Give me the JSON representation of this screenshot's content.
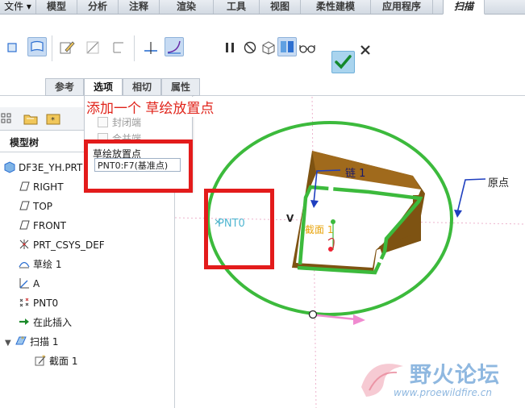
{
  "menubar": {
    "file": "文件",
    "items": [
      "模型",
      "分析",
      "注释",
      "渲染",
      "工具",
      "视图",
      "柔性建模",
      "应用程序"
    ],
    "active": "扫描"
  },
  "subtabs": [
    "参考",
    "选项",
    "相切",
    "属性"
  ],
  "annotation": {
    "text": "添加一个   草绘放置点"
  },
  "options_panel": {
    "closed_ends": "封闭端",
    "merge_ends": "合并端",
    "sketch_placement_label": "草绘放置点",
    "sketch_placement_value": "PNT0:F7(基准点)"
  },
  "model_tree": {
    "title": "模型树",
    "items": [
      {
        "label": "DF3E_YH.PRT",
        "icon": "part-icon"
      },
      {
        "label": "RIGHT",
        "icon": "datum-plane-icon"
      },
      {
        "label": "TOP",
        "icon": "datum-plane-icon"
      },
      {
        "label": "FRONT",
        "icon": "datum-plane-icon"
      },
      {
        "label": "PRT_CSYS_DEF",
        "icon": "csys-icon"
      },
      {
        "label": "草绘 1",
        "icon": "sketch-icon"
      },
      {
        "label": "A",
        "icon": "axis-icon"
      },
      {
        "label": "PNT0",
        "icon": "datum-point-icon"
      },
      {
        "label": "在此插入",
        "icon": "insert-arrow-icon"
      },
      {
        "label": "扫描 1",
        "icon": "sweep-icon"
      },
      {
        "label": "截面 1",
        "icon": "section-icon"
      }
    ]
  },
  "viewport": {
    "point_label": "PNT0",
    "chain_label": "链 1",
    "section_label": "截面 1",
    "origin_label": "原点",
    "v_label": "V"
  },
  "watermark": {
    "title": "野火论坛",
    "url": "www.proewildfire.cn"
  },
  "colors": {
    "annotation_red": "#e31b1b",
    "trajectory_green": "#3cba3c",
    "solid_brown": "#8b5a1a",
    "accent_blue": "#2c6fd1"
  }
}
